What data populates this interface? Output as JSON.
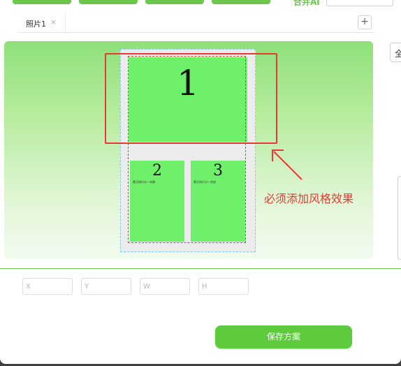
{
  "toolbar": {
    "label": "合并AI"
  },
  "tabs": [
    {
      "label": "照片1",
      "close": "×"
    }
  ],
  "tab_add": "+",
  "canvas": {
    "photos": [
      {
        "number": "1",
        "caption": ""
      },
      {
        "number": "2",
        "caption": "黄河流行分一未删"
      },
      {
        "number": "3",
        "caption": "黄河流行分一完成"
      }
    ],
    "annotation": "必须添加风格效果"
  },
  "right_panel": {
    "label": "全"
  },
  "fields": {
    "x_placeholder": "X",
    "y_placeholder": "Y",
    "w_placeholder": "W",
    "h_placeholder": "H"
  },
  "save_button": "保存方案",
  "colors": {
    "accent": "#6bc84a",
    "annotation_red": "#e53935",
    "photo_green": "#6ff06a"
  }
}
